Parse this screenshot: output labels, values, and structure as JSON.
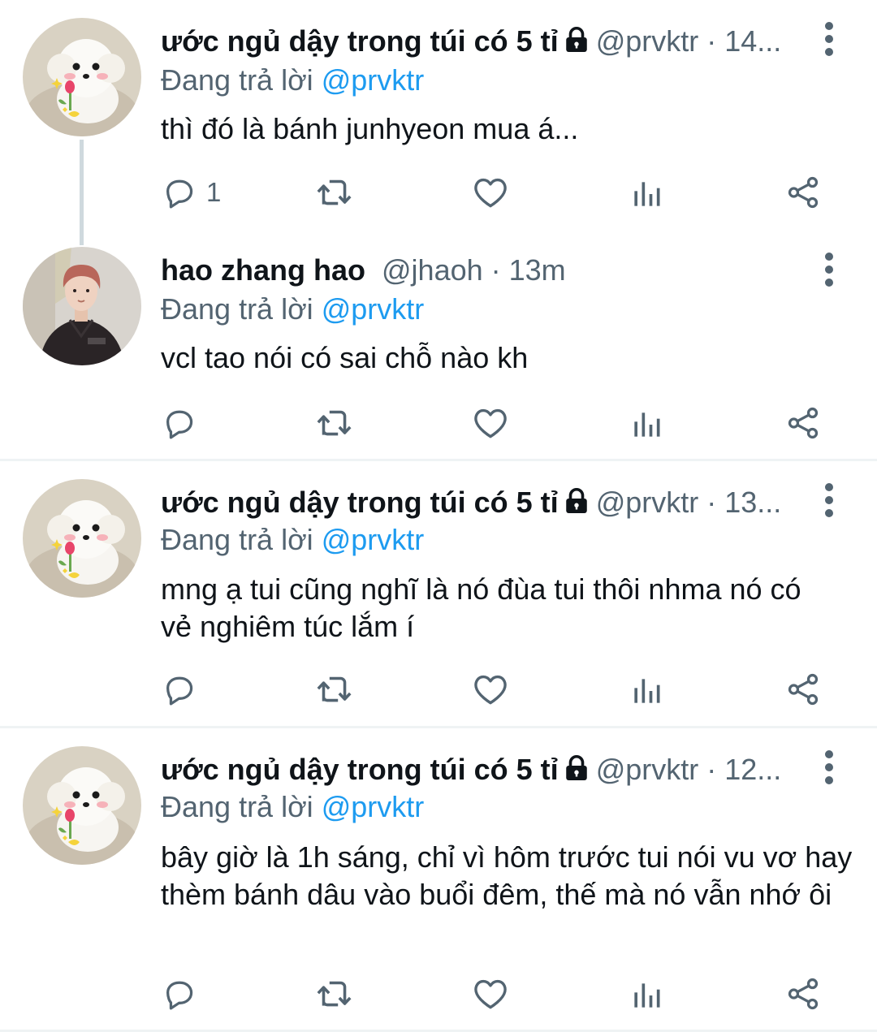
{
  "tweets": [
    {
      "name": "ước ngủ dậy trong túi có 5 tỉ",
      "locked": true,
      "handle": "@prvktr · 14...",
      "reply_label": "Đang trả lời",
      "reply_to": "@prvktr",
      "text": "thì đó là bánh junhyeon mua á...",
      "reply_count": "1",
      "avatar": "white-puppy-avatar"
    },
    {
      "name": "hao zhang hao",
      "locked": false,
      "handle": "@jhaoh · 13m",
      "reply_label": "Đang trả lời",
      "reply_to": "@prvktr",
      "text": "vcl tao nói có sai chỗ nào kh",
      "reply_count": "",
      "avatar": "person-avatar"
    },
    {
      "name": "ước ngủ dậy trong túi có 5 tỉ",
      "locked": true,
      "handle": "@prvktr · 13...",
      "reply_label": "Đang trả lời",
      "reply_to": "@prvktr",
      "text": "mng ạ tui cũng nghĩ là nó đùa tui thôi nhma nó có vẻ nghiêm túc lắm í",
      "reply_count": "",
      "avatar": "white-puppy-avatar"
    },
    {
      "name": "ước ngủ dậy trong túi có 5 tỉ",
      "locked": true,
      "handle": "@prvktr · 12...",
      "reply_label": "Đang trả lời",
      "reply_to": "@prvktr",
      "text": "bây giờ là 1h sáng, chỉ vì hôm trước tui nói vu vơ hay thèm bánh dâu vào buổi đêm, thế mà nó vẫn nhớ ôi",
      "reply_count": "",
      "avatar": "white-puppy-avatar"
    }
  ],
  "icons": {
    "reply": "speech-bubble-icon",
    "retweet": "retweet-arrows-icon",
    "like": "heart-icon",
    "views": "bar-chart-icon",
    "share": "share-nodes-icon",
    "more": "vertical-dots-icon",
    "lock": "lock-icon"
  },
  "colors": {
    "accent": "#1d9bf0",
    "secondary_text": "#536471",
    "primary_text": "#0f1419",
    "thread_line": "#cfd9de",
    "divider": "#eff3f4"
  }
}
